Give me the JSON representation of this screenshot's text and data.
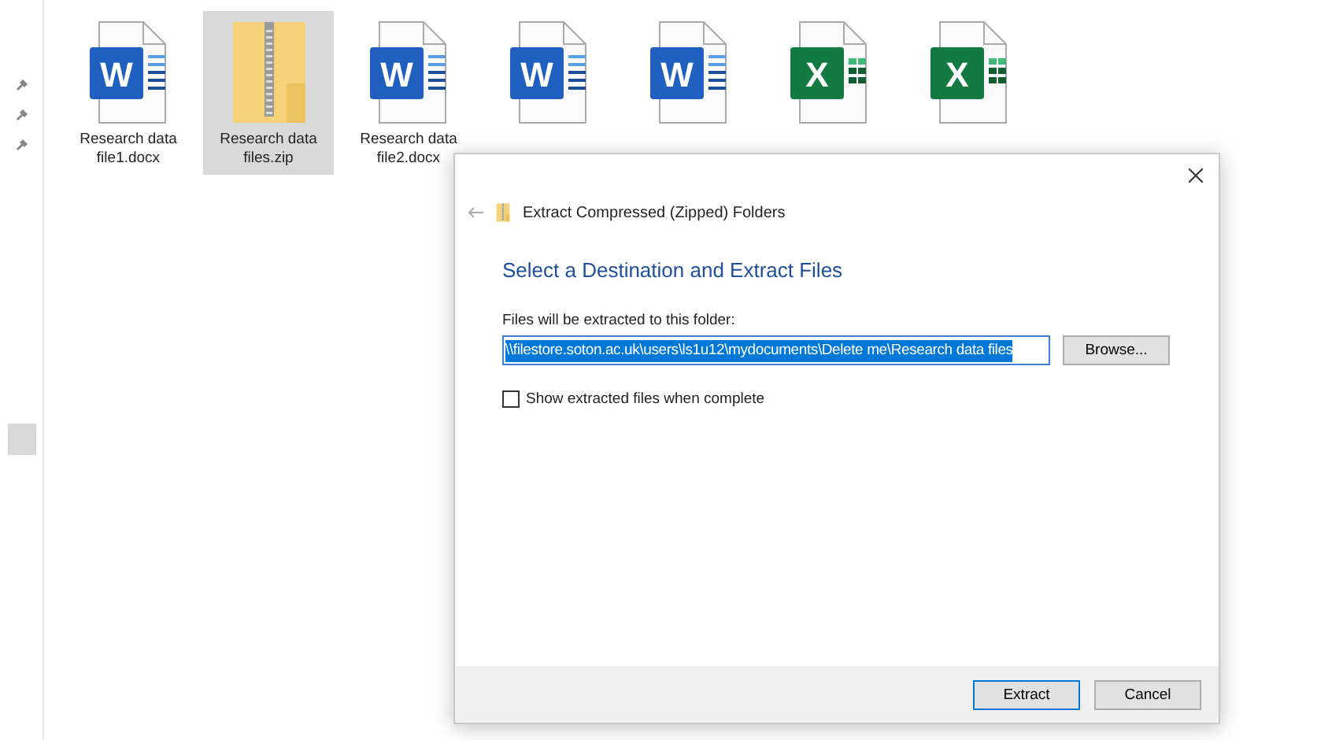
{
  "explorer": {
    "pins": [
      {
        "kind": "pin"
      },
      {
        "kind": "pin"
      },
      {
        "kind": "pin"
      }
    ],
    "files": [
      {
        "kind": "word",
        "letter": "W",
        "label": "Research data file1.docx",
        "selected": false
      },
      {
        "kind": "zip",
        "label": "Research data files.zip",
        "selected": true
      },
      {
        "kind": "word",
        "letter": "W",
        "label": "Research data file2.docx",
        "selected": false
      },
      {
        "kind": "word",
        "letter": "W",
        "selected": false
      },
      {
        "kind": "word",
        "letter": "W",
        "selected": false
      },
      {
        "kind": "excel",
        "letter": "X",
        "selected": false
      },
      {
        "kind": "excel",
        "letter": "X",
        "selected": false
      }
    ]
  },
  "dialog": {
    "title": "Extract Compressed (Zipped) Folders",
    "heading": "Select a Destination and Extract Files",
    "field_label": "Files will be extracted to this folder:",
    "path": "\\\\filestore.soton.ac.uk\\users\\ls1u12\\mydocuments\\Delete me\\Research data files",
    "browse": "Browse...",
    "checkbox": {
      "label": "Show extracted files when complete",
      "checked": false
    },
    "buttons": [
      {
        "label": "Extract",
        "default": true
      },
      {
        "label": "Cancel",
        "default": false
      }
    ]
  }
}
